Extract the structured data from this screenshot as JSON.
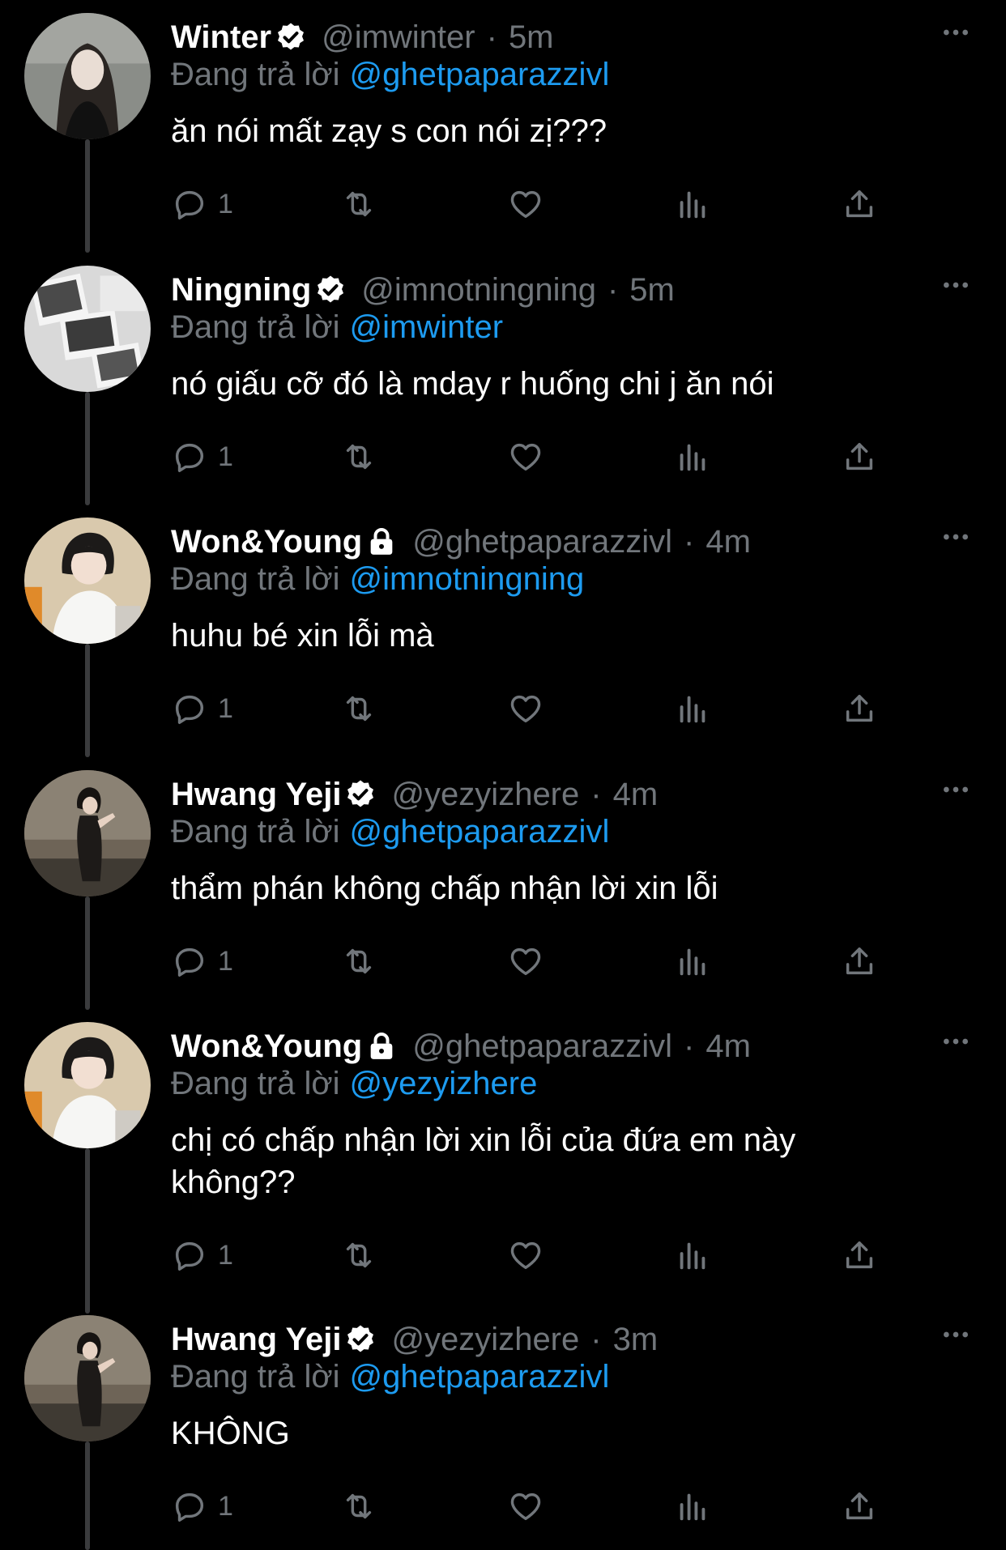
{
  "colors": {
    "background": "#000000",
    "text": "#ffffff",
    "muted": "#71767b",
    "link": "#1d9bf0",
    "thread_line": "#3a3b3d"
  },
  "icons": {
    "reply": "reply-icon",
    "retweet": "retweet-icon",
    "like": "heart-icon",
    "views": "views-icon",
    "share": "share-icon",
    "more": "more-icon",
    "verified": "verified-badge-icon",
    "protected": "lock-icon"
  },
  "replying_label": "Đang trả lời",
  "tweets": [
    {
      "name": "Winter",
      "badge": "verified",
      "handle": "@imwinter",
      "separator": "·",
      "time": "5m",
      "replying_to": "@ghetpaparazzivl",
      "text": "ăn nói mất zạy s con nói zị???",
      "reply_count": "1"
    },
    {
      "name": "Ningning",
      "badge": "verified",
      "handle": "@imnotningning",
      "separator": "·",
      "time": "5m",
      "replying_to": "@imwinter",
      "text": "nó giấu cỡ đó là mday r huống chi j ăn nói",
      "reply_count": "1"
    },
    {
      "name": "Won&Young",
      "badge": "protected",
      "handle": "@ghetpaparazzivl",
      "separator": "·",
      "time": "4m",
      "replying_to": "@imnotningning",
      "text": "huhu bé xin lỗi mà",
      "reply_count": "1"
    },
    {
      "name": "Hwang Yeji",
      "badge": "verified",
      "handle": "@yezyizhere",
      "separator": "·",
      "time": "4m",
      "replying_to": "@ghetpaparazzivl",
      "text": "thẩm phán không chấp nhận lời xin lỗi",
      "reply_count": "1"
    },
    {
      "name": "Won&Young",
      "badge": "protected",
      "handle": "@ghetpaparazzivl",
      "separator": "·",
      "time": "4m",
      "replying_to": "@yezyizhere",
      "text": "chị có chấp nhận lời xin lỗi của đứa em này không??",
      "reply_count": "1"
    },
    {
      "name": "Hwang Yeji",
      "badge": "verified",
      "handle": "@yezyizhere",
      "separator": "·",
      "time": "3m",
      "replying_to": "@ghetpaparazzivl",
      "text": "KHÔNG",
      "reply_count": "1"
    }
  ]
}
